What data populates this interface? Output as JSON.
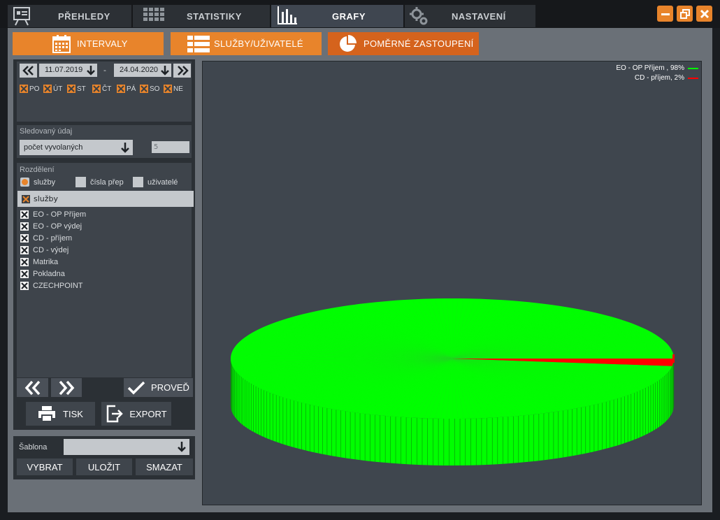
{
  "nav": {
    "tabs": [
      {
        "label": "PŘEHLEDY",
        "icon": "presentation-board-icon"
      },
      {
        "label": "STATISTIKY",
        "icon": "grid-icon"
      },
      {
        "label": "GRAFY",
        "icon": "bar-chart-icon",
        "active": true
      },
      {
        "label": "NASTAVENÍ",
        "icon": "gears-icon"
      }
    ],
    "window_buttons": [
      "minimize-icon",
      "restore-icon",
      "close-icon"
    ]
  },
  "subtabs": [
    {
      "label": "INTERVALY",
      "icon": "calendar-icon"
    },
    {
      "label": "SLUŽBY/UŽIVATELÉ",
      "icon": "list-icon"
    },
    {
      "label": "POMĚRNÉ ZASTOUPENÍ",
      "icon": "pie-icon",
      "active": true
    }
  ],
  "interval": {
    "date_from": "11.07.2019",
    "separator": "-",
    "date_to": "24.04.2020",
    "days": [
      "PO",
      "ÚT",
      "ST",
      "ČT",
      "PÁ",
      "SO",
      "NE"
    ]
  },
  "tracked": {
    "label": "Sledovaný údaj",
    "value": "počet vyvolaných",
    "number": "5"
  },
  "split": {
    "label": "Rozdělení",
    "options": [
      {
        "label": "služby",
        "selected": true
      },
      {
        "label": "čísla přep",
        "selected": false
      },
      {
        "label": "uživatelé",
        "selected": false
      }
    ],
    "header": "služby",
    "items": [
      "EO - OP Příjem",
      "EO - OP výdej",
      "CD - příjem",
      "CD - výdej",
      "Matrika",
      "Pokladna",
      "CZECHPOINT"
    ]
  },
  "actions": {
    "execute": "PROVEĎ",
    "print": "TISK",
    "export": "EXPORT"
  },
  "template": {
    "label": "Šablona",
    "value": "",
    "select": "VYBRAT",
    "save": "ULOŽIT",
    "delete": "SMAZAT"
  },
  "colors": {
    "accent": "#e8842b",
    "series1": "#00ff00",
    "series2": "#ff0000"
  },
  "chart_data": {
    "type": "pie",
    "labels": [
      "EO - OP Příjem , 98%",
      "CD - příjem, 2%"
    ],
    "values": [
      98,
      2
    ],
    "colors": [
      "#00ff00",
      "#ff0000"
    ],
    "legend": "top-right",
    "style": "3d"
  }
}
